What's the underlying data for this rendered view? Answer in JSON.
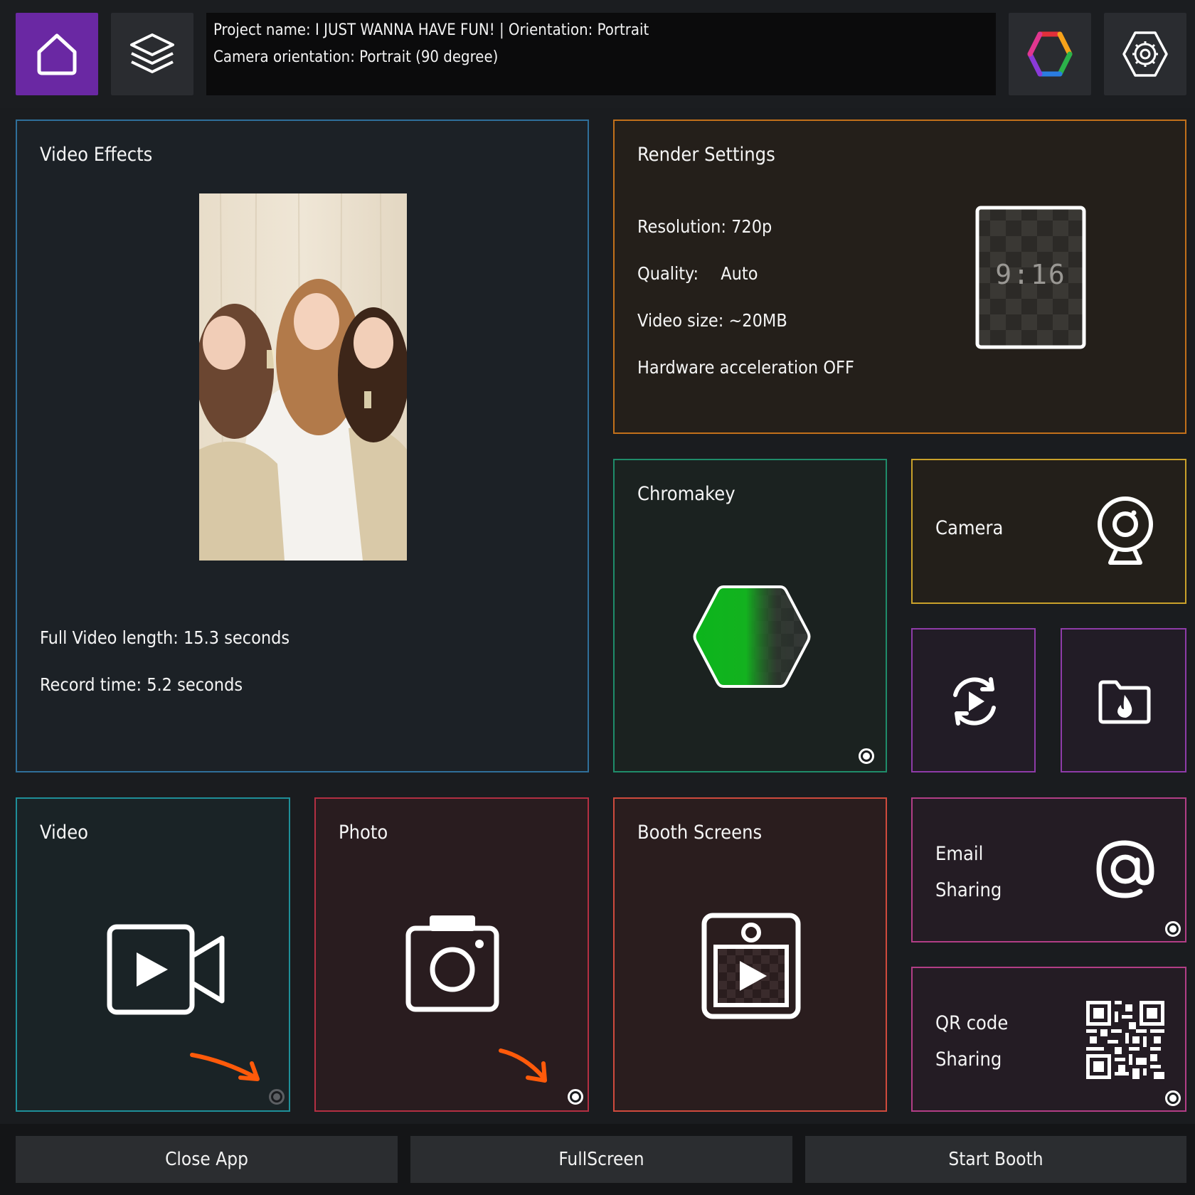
{
  "header": {
    "info_line1": "Project name: I JUST WANNA HAVE FUN! | Orientation: Portrait",
    "info_line2": "Camera orientation: Portrait (90 degree)",
    "icons": [
      "home-icon",
      "layers-icon",
      "color-hexagon-icon",
      "gear-icon"
    ],
    "home_active_color": "#6a28a3"
  },
  "video_effects": {
    "title": "Video Effects",
    "full_length": "Full Video length: 15.3 seconds",
    "record_time": "Record time:  5.2 seconds"
  },
  "render_settings": {
    "title": "Render Settings",
    "resolution": "Resolution: 720p",
    "quality_label": "Quality:",
    "quality_value": "Auto",
    "video_size": "Video size: ~20MB",
    "hw_accel": "Hardware acceleration OFF",
    "aspect_ratio": "9:16"
  },
  "chromakey": {
    "title": "Chromakey",
    "enabled": true
  },
  "camera": {
    "title": "Camera"
  },
  "video": {
    "title": "Video",
    "enabled": false
  },
  "photo": {
    "title": "Photo",
    "enabled": true
  },
  "booth_screens": {
    "title": "Booth Screens"
  },
  "email": {
    "line1": "Email",
    "line2": "Sharing",
    "enabled": true
  },
  "qr": {
    "line1": "QR code",
    "line2": "Sharing",
    "enabled": true
  },
  "footer": {
    "close": "Close App",
    "fullscreen": "FullScreen",
    "start": "Start Booth"
  },
  "colors": {
    "video_effects_border": "#2f6f9a",
    "render_border": "#c2701a",
    "chromakey_border": "#1f8c6a",
    "camera_border": "#c9a12a",
    "purple_border": "#8e3ba8",
    "video_border": "#1f8f99",
    "photo_border": "#b32f42",
    "booth_border": "#cf4a3d",
    "sharing_border": "#b23e86",
    "annotation_arrow": "#ff5a0a"
  }
}
